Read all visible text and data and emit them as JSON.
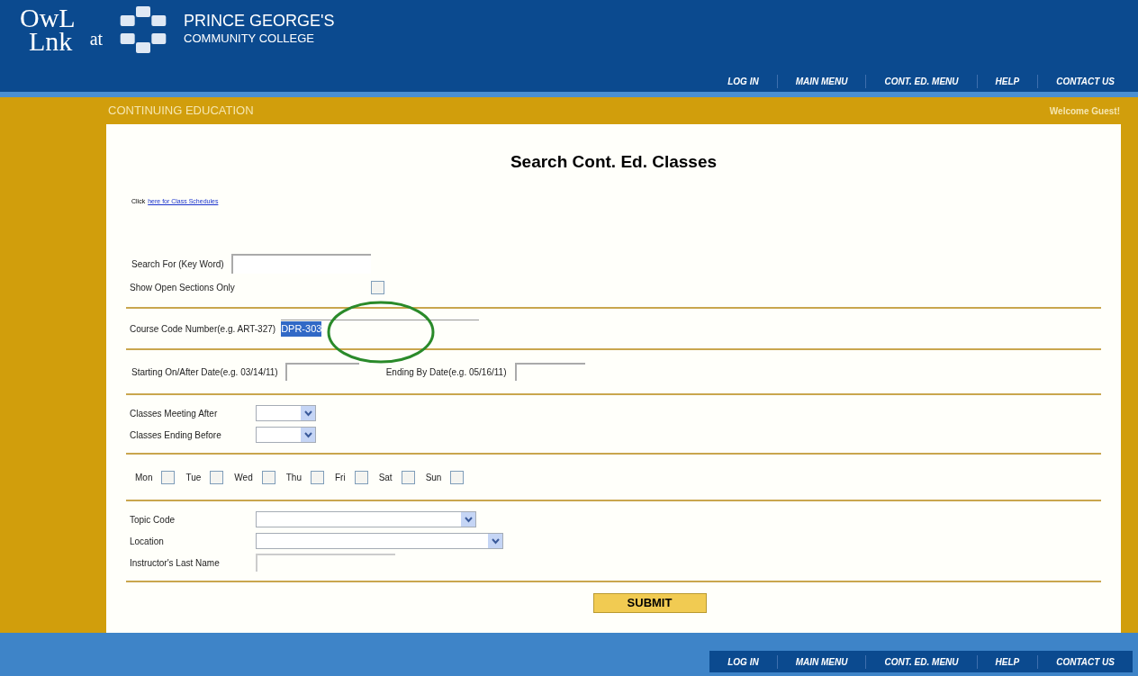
{
  "header": {
    "logo_line1": "OwL",
    "logo_line2": "Lnk",
    "at": "at",
    "college_line1": "PRINCE GEORGE'S",
    "college_line2": "COMMUNITY COLLEGE"
  },
  "nav_top": [
    "LOG IN",
    "MAIN MENU",
    "CONT. ED. MENU",
    "HELP",
    "CONTACT US"
  ],
  "banner": {
    "section": "CONTINUING EDUCATION",
    "welcome": "Welcome Guest!"
  },
  "form": {
    "title": "Search Cont. Ed. Classes",
    "link_prefix": "Click",
    "link": "here for Class Schedules",
    "keyword": {
      "label": "Search For (Key Word)"
    },
    "open_only": {
      "label": "Show Open Sections Only",
      "checked": false
    },
    "course_code": {
      "label": "Course Code Number(e.g. ART-327)",
      "value": "DPR-303",
      "highlighted": true
    },
    "start_date": {
      "label": "Starting On/After Date(e.g. 03/14/11)"
    },
    "end_date": {
      "label": "Ending By Date(e.g. 05/16/11)"
    },
    "meeting_after": {
      "label": "Classes Meeting After"
    },
    "ending_before": {
      "label": "Classes Ending Before"
    },
    "days": [
      {
        "label": "Mon",
        "checked": false
      },
      {
        "label": "Tue",
        "checked": false
      },
      {
        "label": "Wed",
        "checked": false
      },
      {
        "label": "Thu",
        "checked": false
      },
      {
        "label": "Fri",
        "checked": false
      },
      {
        "label": "Sat",
        "checked": false
      },
      {
        "label": "Sun",
        "checked": false
      }
    ],
    "topic_code": {
      "label": "Topic Code"
    },
    "location": {
      "label": "Location"
    },
    "instructor": {
      "label": "Instructor's Last Name"
    },
    "submit": "SUBMIT"
  },
  "nav_bottom": [
    "LOG IN",
    "MAIN MENU",
    "CONT. ED. MENU",
    "HELP",
    "CONTACT US"
  ]
}
